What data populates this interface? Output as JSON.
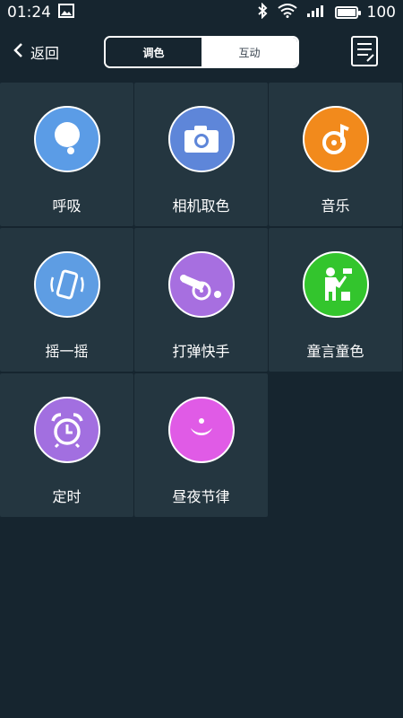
{
  "status": {
    "time": "01:24",
    "battery": "100"
  },
  "header": {
    "back_label": "返回",
    "tabs": [
      {
        "label": "调色",
        "active": true
      },
      {
        "label": "互动",
        "active": false
      }
    ]
  },
  "items": [
    {
      "label": "呼吸",
      "icon": "breath-bubble-icon",
      "color": "#5b9ce6"
    },
    {
      "label": "相机取色",
      "icon": "camera-icon",
      "color": "#5e86d9"
    },
    {
      "label": "音乐",
      "icon": "music-note-icon",
      "color": "#f28a1c"
    },
    {
      "label": "摇一摇",
      "icon": "shake-phone-icon",
      "color": "#5e9de3"
    },
    {
      "label": "打弹快手",
      "icon": "cannon-icon",
      "color": "#a76fe0"
    },
    {
      "label": "童言童色",
      "icon": "child-painting-icon",
      "color": "#33c52d"
    },
    {
      "label": "定时",
      "icon": "alarm-clock-icon",
      "color": "#a26fe0"
    },
    {
      "label": "昼夜节律",
      "icon": "moon-icon",
      "color": "#e05be6"
    }
  ]
}
